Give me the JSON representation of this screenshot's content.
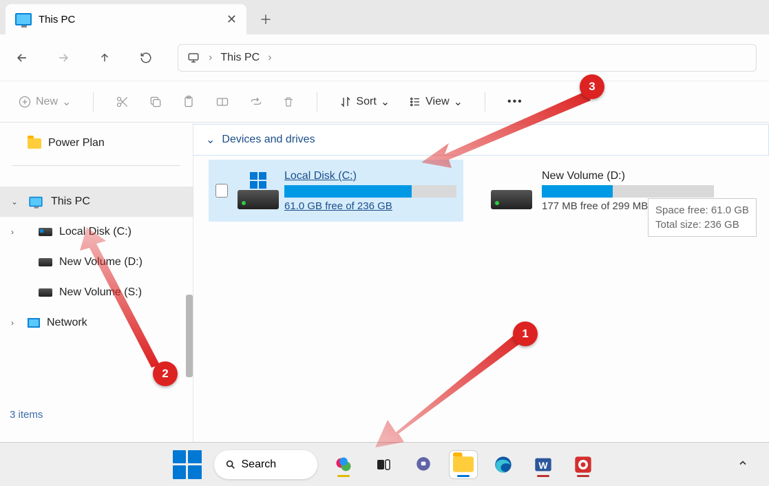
{
  "tab": {
    "title": "This PC"
  },
  "address": {
    "location": "This PC"
  },
  "toolbar": {
    "new": "New",
    "sort": "Sort",
    "view": "View"
  },
  "sidebar": {
    "quick": "Power Plan",
    "items": [
      {
        "label": "This PC"
      },
      {
        "label": "Local Disk (C:)"
      },
      {
        "label": "New Volume (D:)"
      },
      {
        "label": "New Volume (S:)"
      },
      {
        "label": "Network"
      }
    ]
  },
  "section": {
    "title": "Devices and drives"
  },
  "drives": [
    {
      "name": "Local Disk (C:)",
      "free_text": "61.0 GB free of 236 GB",
      "fill_pct": 74
    },
    {
      "name": "New Volume (D:)",
      "free_text": "177 MB free of 299 MB",
      "fill_pct": 41
    }
  ],
  "tooltip": {
    "line1": "Space free: 61.0 GB",
    "line2": "Total size: 236 GB"
  },
  "status": {
    "text": "3 items"
  },
  "taskbar": {
    "search": "Search"
  },
  "annotations": {
    "n1": "1",
    "n2": "2",
    "n3": "3"
  }
}
